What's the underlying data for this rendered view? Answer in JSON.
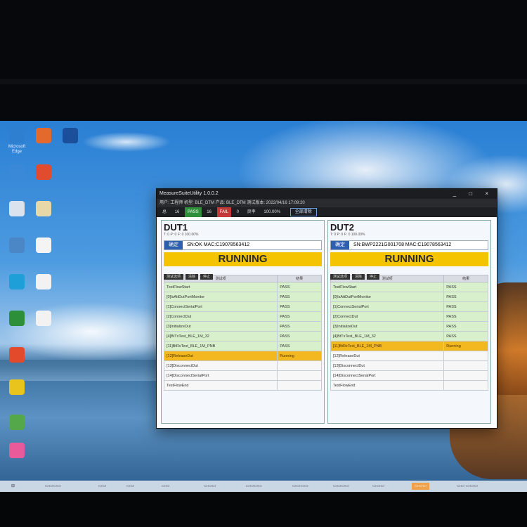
{
  "desktop": {
    "icons": [
      {
        "label": "Microsoft Edge",
        "color": "#2f7fd0"
      },
      {
        "label": "",
        "color": "#e26a2c"
      },
      {
        "label": "",
        "color": "#1b4f9c"
      },
      {
        "label": "",
        "color": "#3a88d8"
      },
      {
        "label": "",
        "color": "#e14b2e"
      },
      {
        "label": "",
        "color": "#dbe3ee"
      },
      {
        "label": "",
        "color": "#e8d8a8"
      },
      {
        "label": "",
        "color": "#4b86c6"
      },
      {
        "label": "",
        "color": "#f4f4f4"
      },
      {
        "label": "",
        "color": "#1f9fd7"
      },
      {
        "label": "",
        "color": "#f2f2f2"
      },
      {
        "label": "",
        "color": "#2e8f3a"
      },
      {
        "label": "",
        "color": "#f2f2f2"
      },
      {
        "label": "",
        "color": "#e34a2c"
      },
      {
        "label": "",
        "color": "#e8c41c"
      },
      {
        "label": "",
        "color": "#54a84a"
      },
      {
        "label": "",
        "color": "#e85a9a"
      }
    ]
  },
  "window": {
    "title": "MeasureSuiteUtility 1.0.0.2",
    "controls": "_ □ ×",
    "info": "用户: 工程师  机型: BLE_DTM  产品: BLE_DTM  测试版本: 2022/04/16 17:09:20",
    "stats": {
      "total_label": "总",
      "total": "16",
      "pass_label": "PASS",
      "pass": "16",
      "fail_label": "FAIL",
      "fail": "0",
      "rate_label": "良率",
      "rate": "100.00%",
      "button": "全部清除"
    }
  },
  "duts": [
    {
      "title": "DUT1",
      "sub": "T: 0  P: 0  F: 0     100.00%",
      "tag": "确定",
      "sn": "SN:OK   MAC:C19078563412",
      "status": "RUNNING",
      "tools": [
        "测试选项",
        "清除",
        "停止"
      ],
      "headers": [
        "测试项",
        "结果"
      ],
      "rows": [
        {
          "name": "TestFlowStart",
          "result": "PASS",
          "state": "pass"
        },
        {
          "name": "[0]IsAttDutPortMonitor",
          "result": "PASS",
          "state": "pass"
        },
        {
          "name": "[1]ConnectSerialPort",
          "result": "PASS",
          "state": "pass"
        },
        {
          "name": "[2]ConnectDut",
          "result": "PASS",
          "state": "pass"
        },
        {
          "name": "[3]InitializeDut",
          "result": "PASS",
          "state": "pass"
        },
        {
          "name": "[4]BtTxTest_BLE_1M_32",
          "result": "PASS",
          "state": "pass"
        },
        {
          "name": "[11]BtRxTest_BLE_1M_PNB",
          "result": "PASS",
          "state": "pass"
        },
        {
          "name": "[12]ReleaseDut",
          "result": "Running",
          "state": "run"
        },
        {
          "name": "[13]DisconnectDut",
          "result": "",
          "state": "wait"
        },
        {
          "name": "[14]DisconnectSerialPort",
          "result": "",
          "state": "wait"
        },
        {
          "name": "TestFlowEnd",
          "result": "",
          "state": "wait"
        }
      ]
    },
    {
      "title": "DUT2",
      "sub": "T: 0  P: 0  F: 0     100.00%",
      "tag": "确定",
      "sn": "SN:BWP2221G001708   MAC:C19078563412",
      "status": "RUNNING",
      "tools": [
        "测试选项",
        "清除",
        "停止"
      ],
      "headers": [
        "测试项",
        "结果"
      ],
      "rows": [
        {
          "name": "TestFlowStart",
          "result": "PASS",
          "state": "pass"
        },
        {
          "name": "[0]IsAttDutPortMonitor",
          "result": "PASS",
          "state": "pass"
        },
        {
          "name": "[1]ConnectSerialPort",
          "result": "PASS",
          "state": "pass"
        },
        {
          "name": "[2]ConnectDut",
          "result": "PASS",
          "state": "pass"
        },
        {
          "name": "[3]InitializeDut",
          "result": "PASS",
          "state": "pass"
        },
        {
          "name": "[4]BtTxTest_BLE_1M_32",
          "result": "PASS",
          "state": "pass"
        },
        {
          "name": "[11]BtRxTest_BLE_1M_PNB",
          "result": "Running",
          "state": "run"
        },
        {
          "name": "[12]ReleaseDut",
          "result": "",
          "state": "wait"
        },
        {
          "name": "[13]DisconnectDut",
          "result": "",
          "state": "wait"
        },
        {
          "name": "[14]DisconnectSerialPort",
          "result": "",
          "state": "wait"
        },
        {
          "name": "TestFlowEnd",
          "result": "",
          "state": "wait"
        }
      ]
    }
  ],
  "taskbar": {
    "items": [
      "",
      "Apps",
      "",
      "",
      "",
      "",
      "",
      "",
      "",
      ""
    ]
  }
}
